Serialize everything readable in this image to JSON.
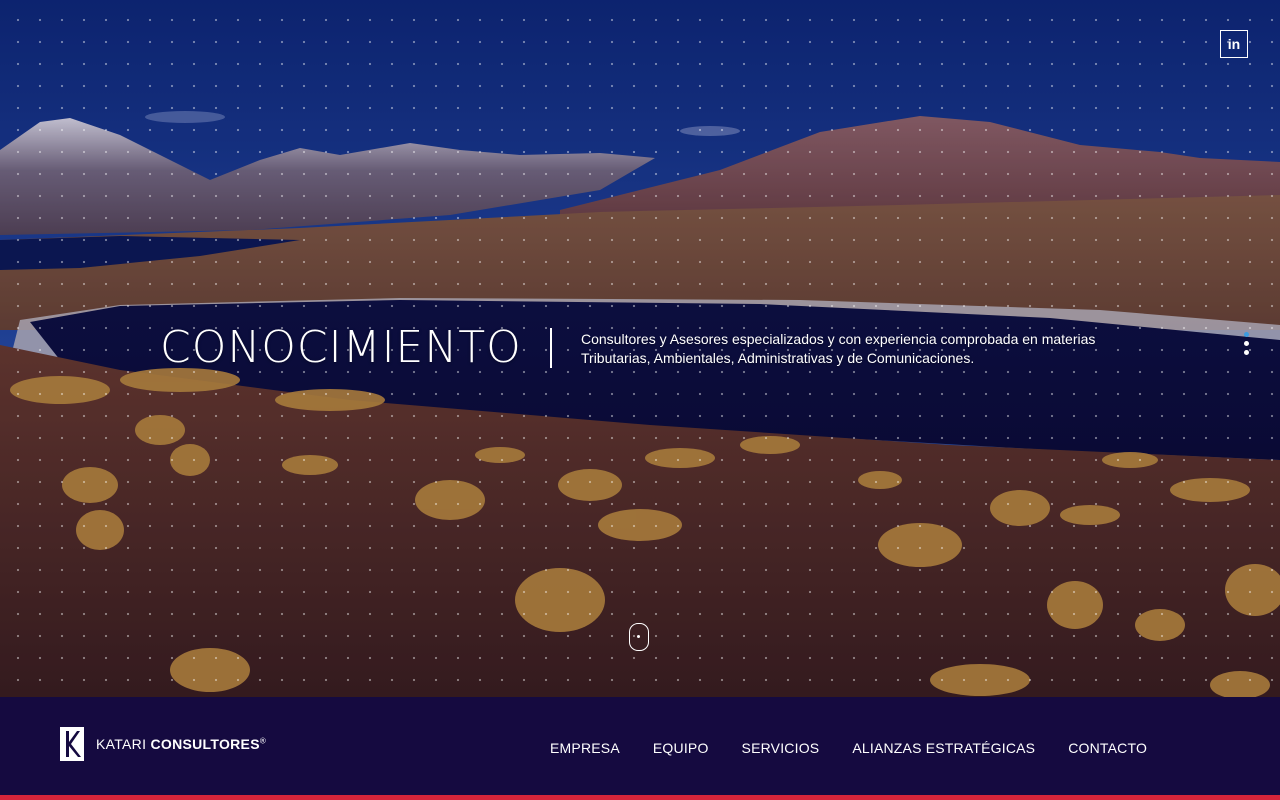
{
  "hero": {
    "headline": "CONOCIMIENTO",
    "description_line1": "Consultores y Asesores especializados y con experiencia comprobada en materias",
    "description_line2": "Tributarias, Ambientales, Administrativas y de Comunicaciones.",
    "slide_count": 3,
    "active_slide": 1
  },
  "social": {
    "linkedin_label": "in",
    "icon": "linkedin-icon"
  },
  "brand": {
    "name_light": "KATARI ",
    "name_bold": "CONSULTORES",
    "trademark": "®"
  },
  "nav": {
    "items": [
      "EMPRESA",
      "EQUIPO",
      "SERVICIOS",
      "ALIANZAS ESTRATÉGICAS",
      "CONTACTO"
    ]
  },
  "colors": {
    "navbar_bg": "#150a40",
    "accent_line": "#d6253a",
    "active_dot": "#3b9be0",
    "text": "#ffffff"
  }
}
